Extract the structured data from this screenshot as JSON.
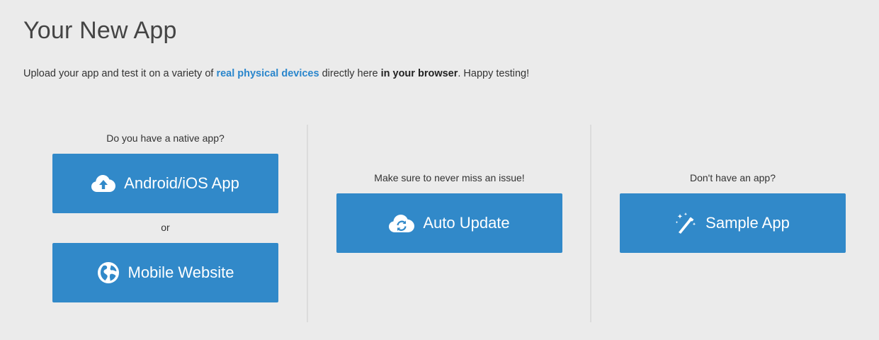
{
  "header": {
    "title": "Your New App"
  },
  "intro": {
    "text_before": "Upload your app and test it on a variety of ",
    "link_text": "real physical devices",
    "text_middle": " directly here ",
    "bold_text": "in your browser",
    "text_after": ". Happy testing!"
  },
  "columns": {
    "native": {
      "caption": "Do you have a native app?",
      "primary_button": {
        "label": "Android/iOS App",
        "icon": "cloud-upload-icon"
      },
      "separator": "or",
      "secondary_button": {
        "label": "Mobile Website",
        "icon": "globe-icon"
      }
    },
    "auto_update": {
      "caption": "Make sure to never miss an issue!",
      "button": {
        "label": "Auto Update",
        "icon": "cloud-refresh-icon"
      }
    },
    "sample": {
      "caption": "Don't have an app?",
      "button": {
        "label": "Sample App",
        "icon": "magic-wand-icon"
      }
    }
  },
  "colors": {
    "background": "#ebebeb",
    "button": "#3189c9",
    "link": "#2a86cc",
    "divider": "#dcdcdc"
  }
}
